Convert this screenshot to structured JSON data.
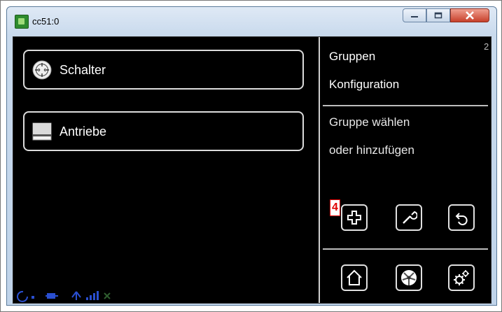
{
  "window": {
    "title": "cc51:0"
  },
  "left_menu": {
    "items": [
      {
        "label": "Schalter",
        "icon": "switch-icon"
      },
      {
        "label": "Antriebe",
        "icon": "blind-drive-icon"
      }
    ]
  },
  "right_panel": {
    "title_line1": "Gruppen",
    "title_line2": "Konfiguration",
    "page_indicator": "2",
    "instruction_line1": "Gruppe wählen",
    "instruction_line2": "oder hinzufügen",
    "marker_label": "4",
    "action_buttons": [
      {
        "name": "add-icon"
      },
      {
        "name": "wrench-icon"
      },
      {
        "name": "back-icon"
      }
    ],
    "nav_buttons": [
      {
        "name": "home-icon"
      },
      {
        "name": "fan-icon"
      },
      {
        "name": "settings-gears-icon"
      }
    ]
  },
  "colors": {
    "panel_bg": "#000000",
    "border": "#dcdcdc",
    "status_blue": "#2a4fd0",
    "status_green": "#2f5e2f",
    "close_button": "#c7402b"
  }
}
